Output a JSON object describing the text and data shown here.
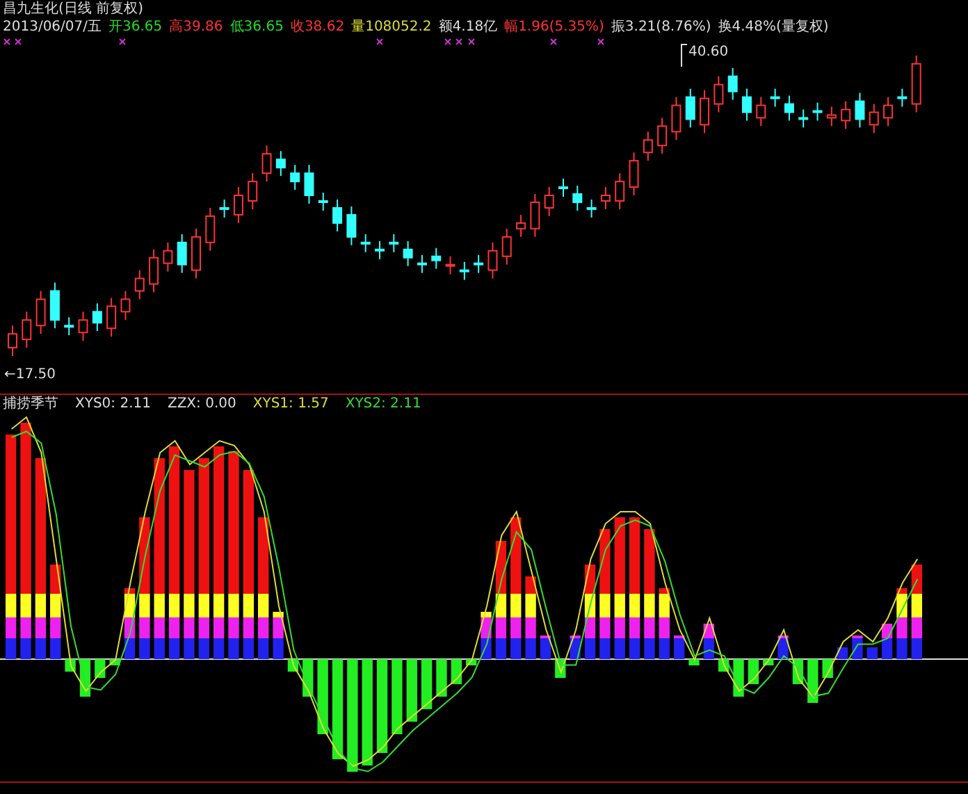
{
  "header": {
    "title": "昌九生化(日线 前复权)",
    "date": "2013/06/07/五",
    "quotes": [
      {
        "label": "开",
        "value": "36.65",
        "color": "#22dd22"
      },
      {
        "label": "高",
        "value": "39.86",
        "color": "#ff3333"
      },
      {
        "label": "低",
        "value": "36.65",
        "color": "#22dd22"
      },
      {
        "label": "收",
        "value": "38.62",
        "color": "#ff3333"
      },
      {
        "label": "量",
        "value": "108052.2",
        "color": "#dddd33"
      },
      {
        "label": "额",
        "value": "4.18亿",
        "color": "#dddddd"
      },
      {
        "label": "幅",
        "value": "1.96(5.35%)",
        "color": "#ff3333"
      },
      {
        "label": "振",
        "value": "3.21(8.76%)",
        "color": "#dddddd"
      },
      {
        "label": "换",
        "value": "4.48%(量复权)",
        "color": "#dddddd"
      }
    ]
  },
  "price_chart": {
    "high_label": "40.60",
    "low_label": "←17.50"
  },
  "indicator": {
    "name": "捕捞季节",
    "legend": [
      {
        "text": "XYS0: 2.11",
        "color": "#dddddd"
      },
      {
        "text": "ZZX: 0.00",
        "color": "#dddddd"
      },
      {
        "text": "XYS1: 1.57",
        "color": "#dddd33"
      },
      {
        "text": "XYS2: 2.11",
        "color": "#33dd33"
      }
    ]
  }
}
